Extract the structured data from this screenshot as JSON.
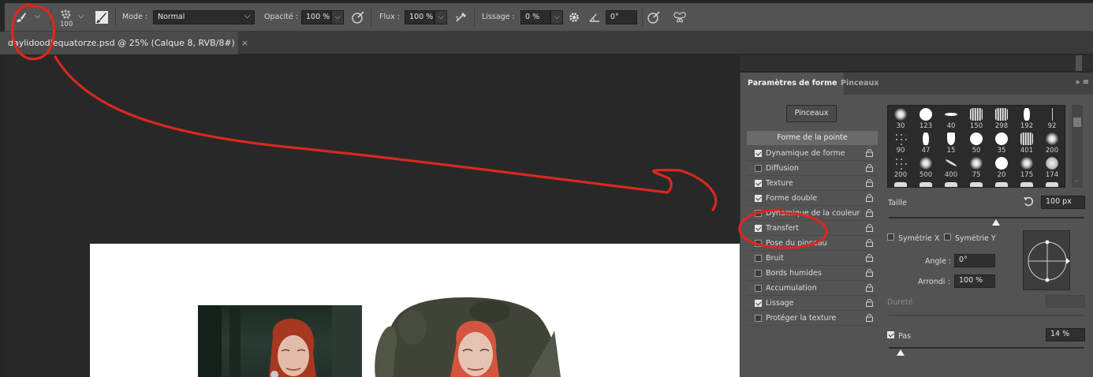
{
  "options_bar": {
    "brush_size": "100",
    "mode_label": "Mode :",
    "mode_value": "Normal",
    "opacity_label": "Opacité :",
    "opacity_value": "100 %",
    "flow_label": "Flux :",
    "flow_value": "100 %",
    "smoothing_label": "Lissage :",
    "smoothing_value": "0 %",
    "angle_value": "0°"
  },
  "document_tab": {
    "title": "daylidoodlequatorze.psd @ 25% (Calque 8, RVB/8#)",
    "close": "×"
  },
  "panel": {
    "tabs": [
      {
        "label": "Paramètres de forme"
      },
      {
        "label": "Pinceaux"
      }
    ],
    "menu_glyph": "»  ≡",
    "pinceaux_button": "Pinceaux",
    "tip_header": "Forme de la pointe",
    "options": [
      {
        "label": "Dynamique de forme",
        "checked": true
      },
      {
        "label": "Diffusion",
        "checked": false
      },
      {
        "label": "Texture",
        "checked": true
      },
      {
        "label": "Forme double",
        "checked": true
      },
      {
        "label": "Dynamique de la couleur",
        "checked": false
      },
      {
        "label": "Transfert",
        "checked": true
      },
      {
        "label": "Pose du pinceau",
        "checked": false
      },
      {
        "label": "Bruit",
        "checked": false
      },
      {
        "label": "Bords humides",
        "checked": false
      },
      {
        "label": "Accumulation",
        "checked": false
      },
      {
        "label": "Lissage",
        "checked": true
      },
      {
        "label": "Protéger la texture",
        "checked": false
      }
    ],
    "brush_presets": [
      {
        "size": "30",
        "style": "soft"
      },
      {
        "size": "123",
        "style": "hard"
      },
      {
        "size": "40",
        "style": "flat"
      },
      {
        "size": "150",
        "style": "bristle"
      },
      {
        "size": "298",
        "style": "bristle"
      },
      {
        "size": "192",
        "style": "diamond"
      },
      {
        "size": "92",
        "style": "line"
      },
      {
        "size": "90",
        "style": "scatter"
      },
      {
        "size": "47",
        "style": "diamond"
      },
      {
        "size": "15",
        "style": "shield"
      },
      {
        "size": "50",
        "style": "hard"
      },
      {
        "size": "35",
        "style": "hard"
      },
      {
        "size": "401",
        "style": "bristle"
      },
      {
        "size": "200",
        "style": "soft"
      },
      {
        "size": "200",
        "style": "scatter"
      },
      {
        "size": "500",
        "style": "soft"
      },
      {
        "size": "400",
        "style": "stroke"
      },
      {
        "size": "75",
        "style": "soft"
      },
      {
        "size": "20",
        "style": "hard"
      },
      {
        "size": "175",
        "style": "soft"
      },
      {
        "size": "174",
        "style": "blob"
      }
    ],
    "size_label": "Taille",
    "size_value": "100 px",
    "size_fraction": 0.55,
    "symmetry_x": "Symétrie X",
    "symmetry_y": "Symétrie Y",
    "angle_label": "Angle :",
    "angle_value": "0°",
    "roundness_label": "Arrondi :",
    "roundness_value": "100 %",
    "hardness_label": "Dureté",
    "spacing_label": "Pas",
    "spacing_value": "14 %",
    "spacing_fraction": 0.06
  },
  "colors": {
    "annotation_red": "#d9281e",
    "panel_bg": "#535353",
    "canvas_bg": "#282828"
  }
}
